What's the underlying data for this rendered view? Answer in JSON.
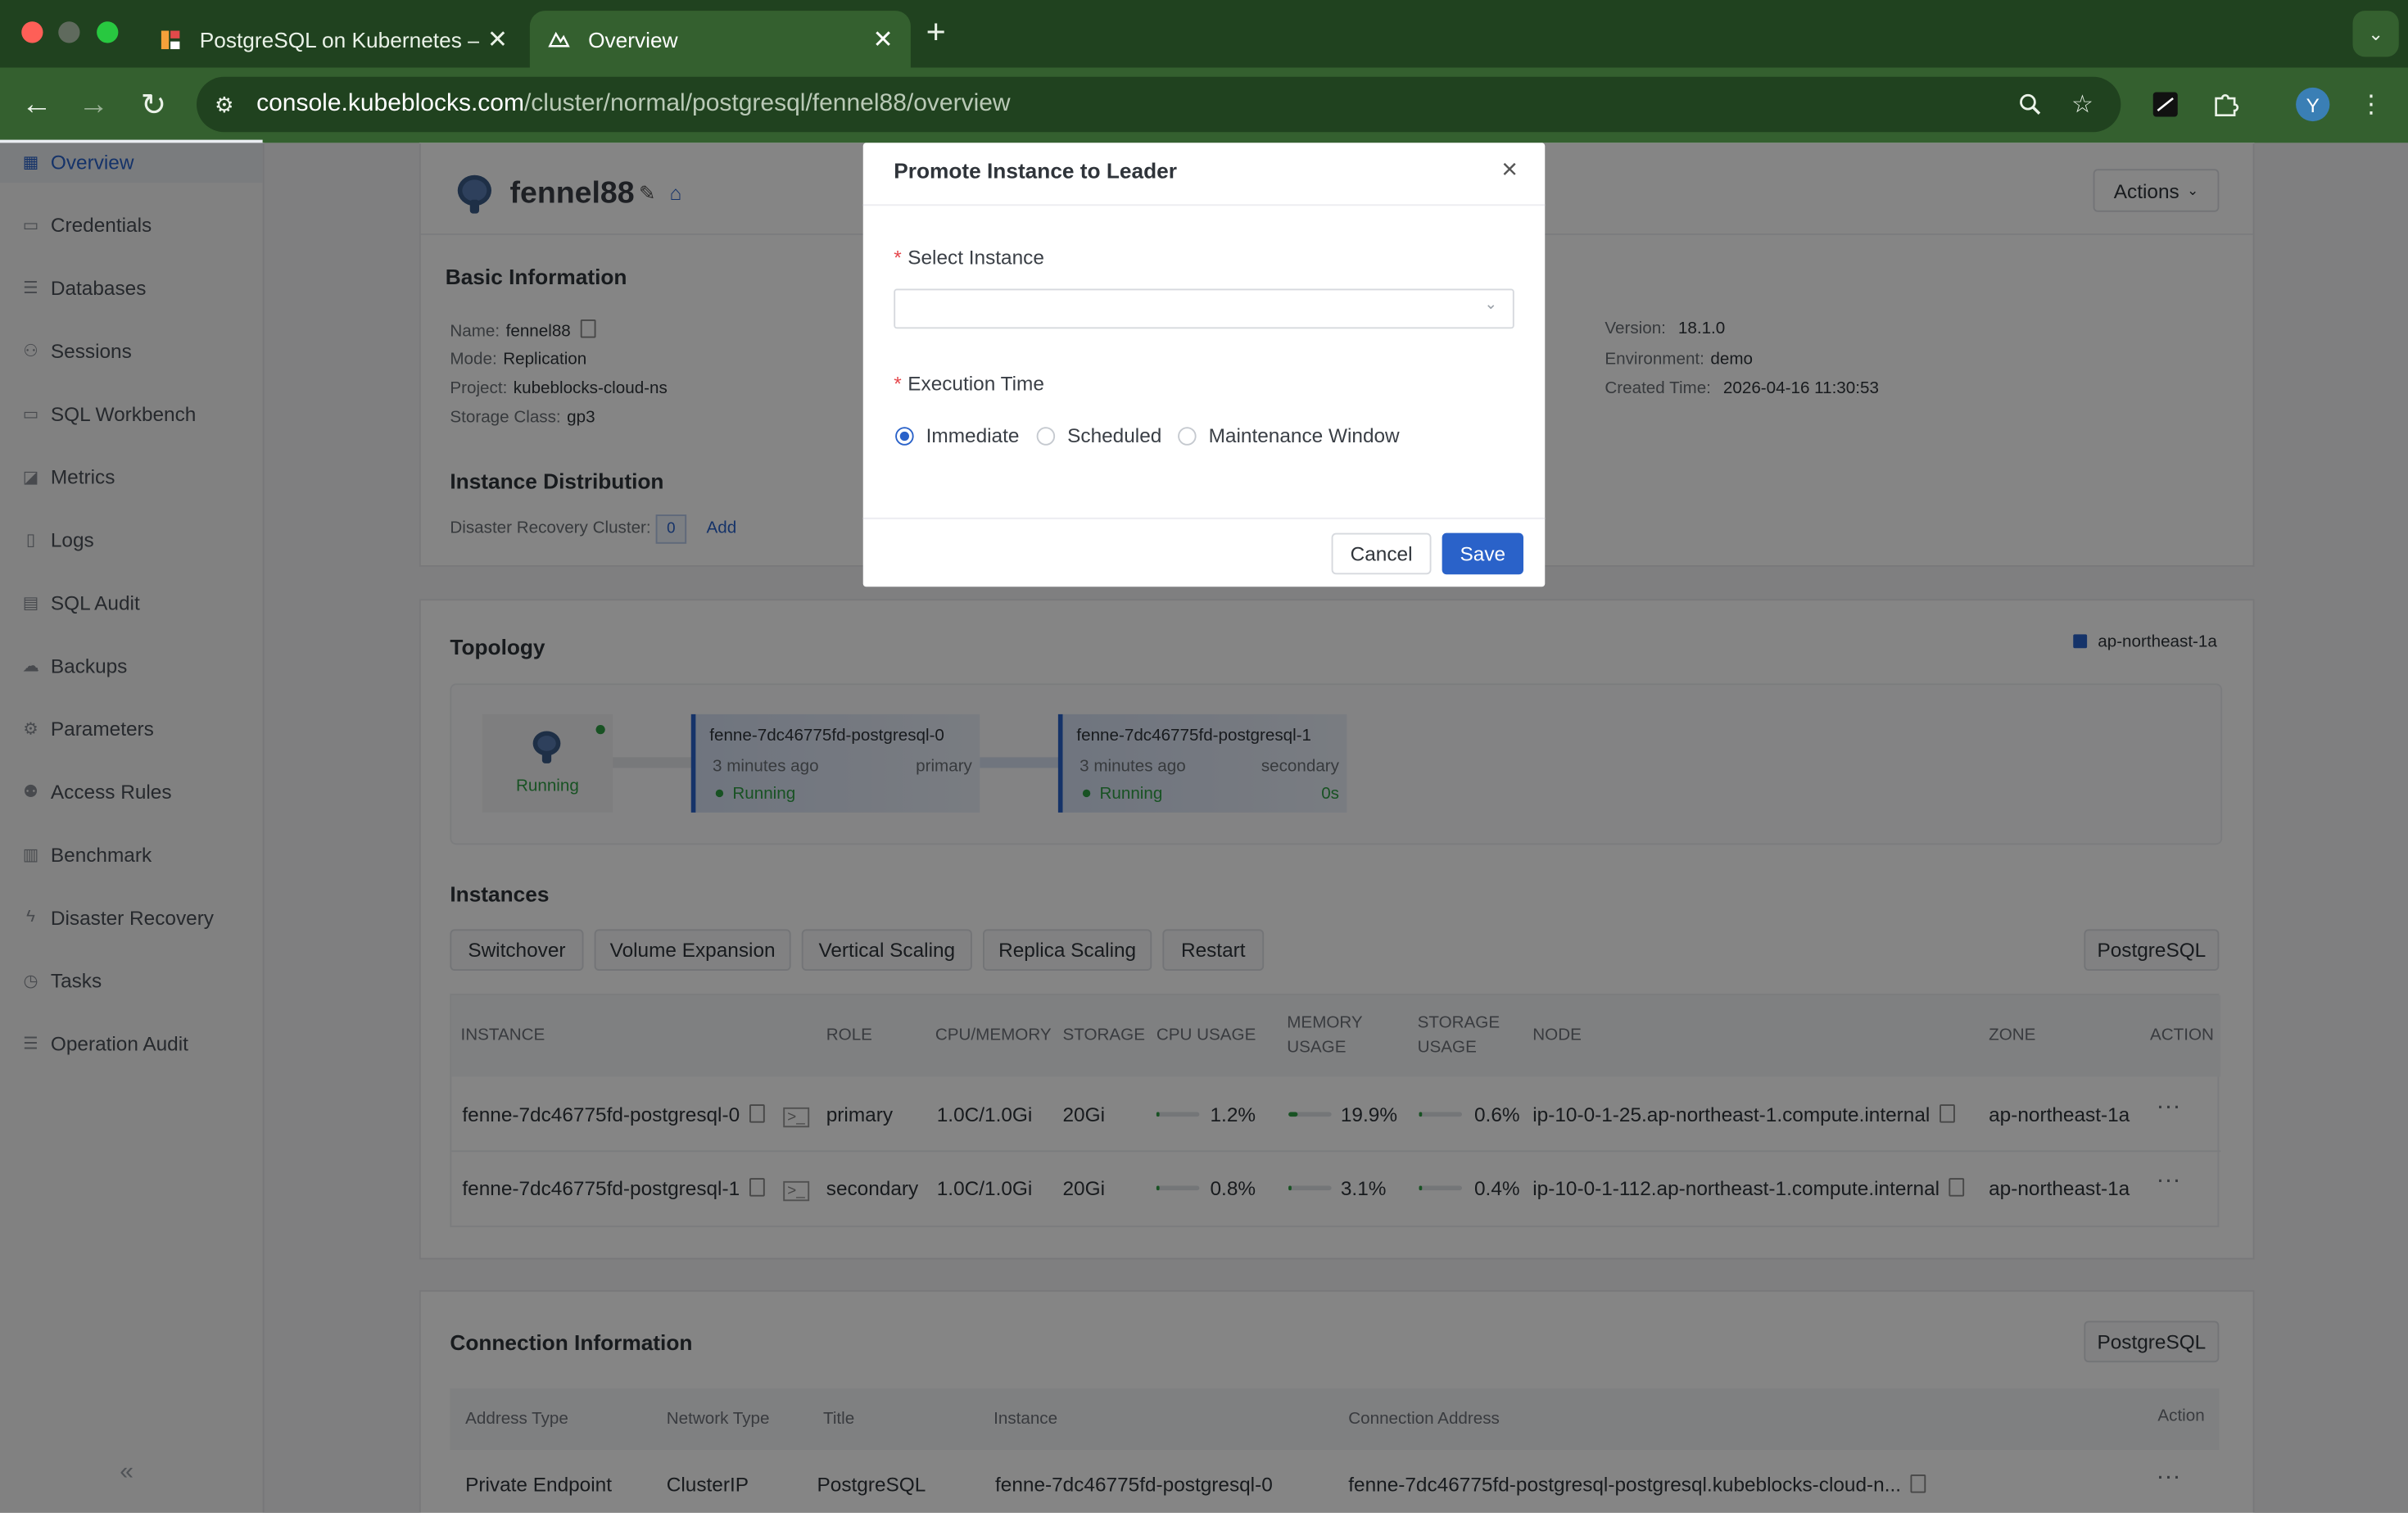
{
  "browser": {
    "tabs": [
      {
        "title": "PostgreSQL on Kubernetes —",
        "active": false
      },
      {
        "title": "Overview",
        "active": true
      }
    ],
    "url_host": "console.kubeblocks.com",
    "url_path": "/cluster/normal/postgresql/fennel88/overview",
    "profile_initial": "Y"
  },
  "sidebar": {
    "items": [
      {
        "label": "Overview",
        "icon": "grid-icon",
        "active": true
      },
      {
        "label": "Credentials",
        "icon": "id-card-icon"
      },
      {
        "label": "Databases",
        "icon": "database-icon"
      },
      {
        "label": "Sessions",
        "icon": "sessions-icon"
      },
      {
        "label": "SQL Workbench",
        "icon": "monitor-icon"
      },
      {
        "label": "Metrics",
        "icon": "chart-icon"
      },
      {
        "label": "Logs",
        "icon": "file-icon"
      },
      {
        "label": "SQL Audit",
        "icon": "audit-icon"
      },
      {
        "label": "Backups",
        "icon": "cloud-icon"
      },
      {
        "label": "Parameters",
        "icon": "gear-icon"
      },
      {
        "label": "Access Rules",
        "icon": "users-icon"
      },
      {
        "label": "Benchmark",
        "icon": "benchmark-icon"
      },
      {
        "label": "Disaster Recovery",
        "icon": "bolt-icon"
      },
      {
        "label": "Tasks",
        "icon": "clock-icon"
      },
      {
        "label": "Operation Audit",
        "icon": "list-icon"
      }
    ],
    "collapse_glyph": "«"
  },
  "cluster": {
    "name": "fennel88",
    "actions_label": "Actions"
  },
  "basic_info": {
    "title": "Basic Information",
    "left": [
      {
        "k": "Name:",
        "v": "fennel88"
      },
      {
        "k": "Mode:",
        "v": "Replication"
      },
      {
        "k": "Project:",
        "v": "kubeblocks-cloud-ns"
      },
      {
        "k": "Storage Class:",
        "v": "gp3"
      }
    ],
    "right": [
      {
        "k": "Version:",
        "v": "18.1.0"
      },
      {
        "k": "Environment:",
        "v": "demo"
      },
      {
        "k": "Created Time:",
        "v": "2026-04-16 11:30:53"
      }
    ]
  },
  "distribution": {
    "title": "Instance Distribution",
    "dr_label": "Disaster Recovery Cluster:",
    "dr_count": "0",
    "add_label": "Add"
  },
  "topology": {
    "title": "Topology",
    "zone_legend": "ap-northeast-1a",
    "cluster_status": "Running",
    "nodes": [
      {
        "name": "fenne-7dc46775fd-postgresql-0",
        "age": "3 minutes ago",
        "role": "primary",
        "status": "Running",
        "lag": ""
      },
      {
        "name": "fenne-7dc46775fd-postgresql-1",
        "age": "3 minutes ago",
        "role": "secondary",
        "status": "Running",
        "lag": "0s"
      }
    ]
  },
  "instances": {
    "title": "Instances",
    "ops": [
      "Switchover",
      "Volume Expansion",
      "Vertical Scaling",
      "Replica Scaling",
      "Restart"
    ],
    "engine_label": "PostgreSQL",
    "headers": {
      "instance": "INSTANCE",
      "role": "ROLE",
      "cpu_mem": "CPU/MEMORY",
      "storage": "STORAGE",
      "cpu_usage": "CPU USAGE",
      "mem_usage_1": "MEMORY",
      "mem_usage_2": "USAGE",
      "storage_usage_1": "STORAGE",
      "storage_usage_2": "USAGE",
      "node": "NODE",
      "zone": "ZONE",
      "action": "ACTION"
    },
    "rows": [
      {
        "instance": "fenne-7dc46775fd-postgresql-0",
        "role": "primary",
        "cpu_mem": "1.0C/1.0Gi",
        "storage": "20Gi",
        "cpu_usage": "1.2%",
        "cpu_frac": 0.012,
        "mem_usage": "19.9%",
        "mem_frac": 0.199,
        "storage_usage": "0.6%",
        "storage_frac": 0.006,
        "node": "ip-10-0-1-25.ap-northeast-1.compute.internal",
        "zone": "ap-northeast-1a"
      },
      {
        "instance": "fenne-7dc46775fd-postgresql-1",
        "role": "secondary",
        "cpu_mem": "1.0C/1.0Gi",
        "storage": "20Gi",
        "cpu_usage": "0.8%",
        "cpu_frac": 0.008,
        "mem_usage": "3.1%",
        "mem_frac": 0.031,
        "storage_usage": "0.4%",
        "storage_frac": 0.004,
        "node": "ip-10-0-1-112.ap-northeast-1.compute.internal",
        "zone": "ap-northeast-1a"
      }
    ],
    "row_action": "···"
  },
  "connection": {
    "title": "Connection Information",
    "engine_label": "PostgreSQL",
    "headers": {
      "address_type": "Address Type",
      "network_type": "Network Type",
      "title": "Title",
      "instance": "Instance",
      "address": "Connection Address",
      "action": "Action"
    },
    "rows": [
      {
        "address_type": "Private Endpoint",
        "network_type": "ClusterIP",
        "title": "PostgreSQL",
        "instance": "fenne-7dc46775fd-postgresql-0",
        "address": "fenne-7dc46775fd-postgresql-postgresql.kubeblocks-cloud-n..."
      }
    ],
    "row_action": "···"
  },
  "modal": {
    "title": "Promote Instance to Leader",
    "select_label": "Select Instance",
    "select_value": "",
    "time_label": "Execution Time",
    "required_mark": "*",
    "options": [
      {
        "label": "Immediate",
        "checked": true
      },
      {
        "label": "Scheduled",
        "checked": false
      },
      {
        "label": "Maintenance Window",
        "checked": false
      }
    ],
    "cancel_label": "Cancel",
    "save_label": "Save"
  },
  "colors": {
    "accent": "#2a62c9",
    "running": "#2f9e44",
    "browser_frame": "#34602f"
  }
}
